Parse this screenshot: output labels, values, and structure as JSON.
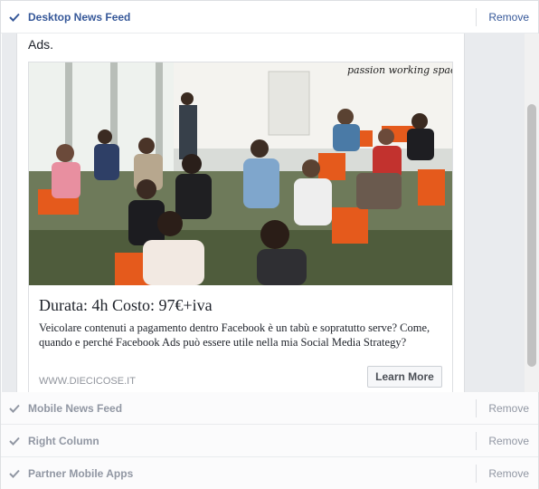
{
  "placements": {
    "desktop_news_feed": {
      "label": "Desktop News Feed",
      "remove": "Remove"
    },
    "mobile_news_feed": {
      "label": "Mobile News Feed",
      "remove": "Remove"
    },
    "right_column": {
      "label": "Right Column",
      "remove": "Remove"
    },
    "partner_mobile_apps": {
      "label": "Partner Mobile Apps",
      "remove": "Remove"
    }
  },
  "preview": {
    "post_text": "Ads.",
    "ad": {
      "image_sign_text": "passion working space",
      "headline": "Durata: 4h Costo: 97€+iva",
      "description": "Veicolare contenuti a pagamento dentro Facebook è un tabù e sopratutto serve? Come, quando e perché Facebook Ads può essere utile nella mia Social Media Strategy?",
      "domain": "WWW.DIECICOSE.IT",
      "cta_label": "Learn More"
    }
  },
  "colors": {
    "active_label": "#365899",
    "inactive_label": "#9197a3",
    "check_active": "#365899",
    "check_inactive": "#9197a3"
  },
  "icons": {
    "check": "check-icon"
  }
}
